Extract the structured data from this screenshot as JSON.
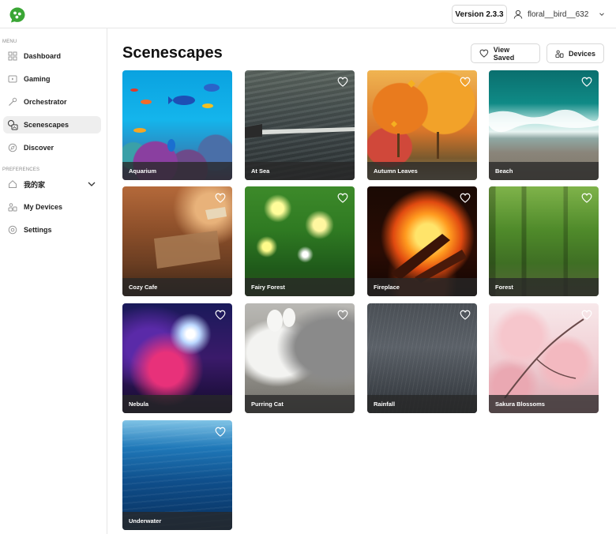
{
  "header": {
    "version_label": "Version 2.3.3",
    "username": "floral__bird__632"
  },
  "sidebar": {
    "menu_label": "MENU",
    "menu_items": [
      {
        "label": "Dashboard",
        "icon": "dashboard-icon"
      },
      {
        "label": "Gaming",
        "icon": "gaming-icon"
      },
      {
        "label": "Orchestrator",
        "icon": "orchestrator-icon"
      },
      {
        "label": "Scenescapes",
        "icon": "scenescapes-icon"
      },
      {
        "label": "Discover",
        "icon": "discover-icon"
      }
    ],
    "preferences_label": "PREFERENCES",
    "preference_items": [
      {
        "label": "我的家",
        "icon": "home-icon"
      },
      {
        "label": "My Devices",
        "icon": "devices-icon"
      },
      {
        "label": "Settings",
        "icon": "settings-icon"
      }
    ],
    "active_item": "Scenescapes"
  },
  "main": {
    "title": "Scenescapes",
    "view_saved_label": "View Saved",
    "devices_label": "Devices",
    "scenes": [
      {
        "label": "Aquarium"
      },
      {
        "label": "At Sea"
      },
      {
        "label": "Autumn Leaves"
      },
      {
        "label": "Beach"
      },
      {
        "label": "Cozy Cafe"
      },
      {
        "label": "Fairy Forest"
      },
      {
        "label": "Fireplace"
      },
      {
        "label": "Forest"
      },
      {
        "label": "Nebula"
      },
      {
        "label": "Purring Cat"
      },
      {
        "label": "Rainfall"
      },
      {
        "label": "Sakura Blossoms"
      },
      {
        "label": "Underwater"
      }
    ]
  },
  "colors": {
    "brand_green": "#3aa635",
    "active_nav_bg": "#eeeeee",
    "label_bar": "#282828"
  }
}
